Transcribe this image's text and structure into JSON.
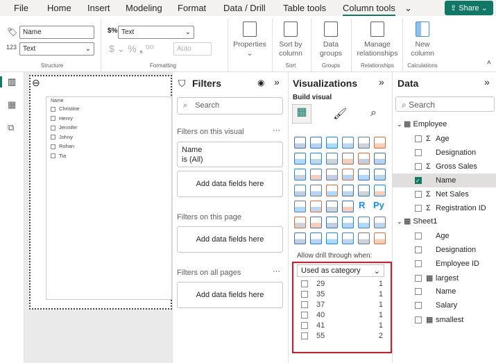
{
  "tabs": [
    "File",
    "Home",
    "Insert",
    "Modeling",
    "Format",
    "Data / Drill",
    "Table tools",
    "Column tools"
  ],
  "share_label": "Share",
  "ribbon": {
    "name_value": "Name",
    "data_type": "Text",
    "format": "Text",
    "decimals_placeholder": "Auto",
    "symbols": "$ ⌄ % ❟ ⁰⁰",
    "properties": "Properties",
    "sort_by": "Sort by column",
    "data_groups": "Data groups",
    "manage_rel": "Manage relationships",
    "new_column": "New column",
    "groups": {
      "structure": "Structure",
      "formatting": "Formatting",
      "sort": "Sort",
      "groups": "Groups",
      "relationships": "Relationships",
      "calculations": "Calculations"
    }
  },
  "slicer": {
    "header": "Name",
    "items": [
      "Christine",
      "Henry",
      "Jennifer",
      "Johny",
      "Rohan",
      "Tia"
    ]
  },
  "filters": {
    "title": "Filters",
    "search": "Search",
    "on_visual": "Filters on this visual",
    "card_field": "Name",
    "card_value": "is (All)",
    "add": "Add data fields here",
    "on_page": "Filters on this page",
    "on_all": "Filters on all pages"
  },
  "viz": {
    "title": "Visualizations",
    "build": "Build visual",
    "drill_label": "Allow drill through when:",
    "drill_select": "Used as category",
    "values": [
      {
        "v": "29",
        "c": "1"
      },
      {
        "v": "35",
        "c": "1"
      },
      {
        "v": "37",
        "c": "1"
      },
      {
        "v": "40",
        "c": "1"
      },
      {
        "v": "41",
        "c": "1"
      },
      {
        "v": "55",
        "c": "2"
      }
    ],
    "more": "···",
    "r_label": "R",
    "py_label": "Py"
  },
  "data": {
    "title": "Data",
    "search": "Search",
    "tables": [
      {
        "name": "Employee",
        "fields": [
          {
            "n": "Age",
            "s": "Σ",
            "chk": false
          },
          {
            "n": "Designation",
            "s": "",
            "chk": false
          },
          {
            "n": "Gross Sales",
            "s": "Σ",
            "chk": false
          },
          {
            "n": "Name",
            "s": "",
            "chk": true
          },
          {
            "n": "Net Sales",
            "s": "Σ",
            "chk": false
          },
          {
            "n": "Registration ID",
            "s": "Σ",
            "chk": false
          }
        ]
      },
      {
        "name": "Sheet1",
        "fields": [
          {
            "n": "Age",
            "s": "",
            "chk": false
          },
          {
            "n": "Designation",
            "s": "",
            "chk": false
          },
          {
            "n": "Employee ID",
            "s": "",
            "chk": false
          },
          {
            "n": "largest",
            "s": "▦",
            "chk": false
          },
          {
            "n": "Name",
            "s": "",
            "chk": false
          },
          {
            "n": "Salary",
            "s": "",
            "chk": false
          },
          {
            "n": "smallest",
            "s": "▦",
            "chk": false
          }
        ]
      }
    ]
  },
  "colors": {
    "accent": "#117865",
    "highlight": "#d83b01",
    "box": "#e81123"
  }
}
